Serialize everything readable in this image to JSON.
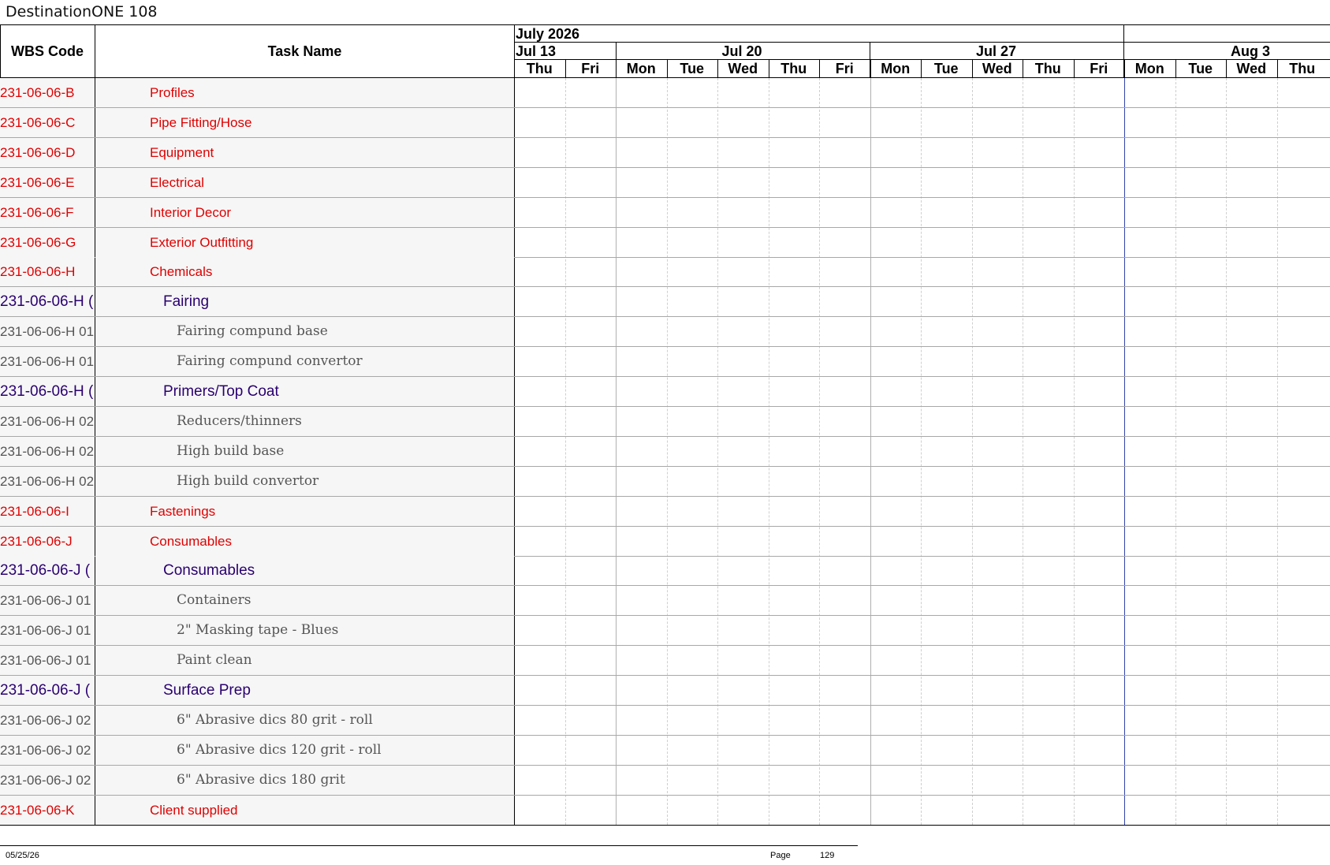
{
  "doc_title": "DestinationONE 108",
  "columns": {
    "wbs": "WBS Code",
    "task": "Task Name"
  },
  "timeline": {
    "month": "July 2026",
    "weeks": [
      "Jul 13",
      "Jul 20",
      "Jul 27",
      "Aug 3"
    ],
    "days": [
      "Thu",
      "Fri",
      "Mon",
      "Tue",
      "Wed",
      "Thu",
      "Fri",
      "Mon",
      "Tue",
      "Wed",
      "Thu",
      "Fri",
      "Mon",
      "Tue",
      "Wed",
      "Thu"
    ]
  },
  "rows": [
    {
      "wbs": "231-06-06-B",
      "task": "Profiles",
      "level": 1
    },
    {
      "wbs": "231-06-06-C",
      "task": "Pipe Fitting/Hose",
      "level": 1
    },
    {
      "wbs": "231-06-06-D",
      "task": "Equipment",
      "level": 1
    },
    {
      "wbs": "231-06-06-E",
      "task": "Electrical",
      "level": 1
    },
    {
      "wbs": "231-06-06-F",
      "task": "Interior Decor",
      "level": 1
    },
    {
      "wbs": "231-06-06-G",
      "task": "Exterior Outfitting",
      "level": 1
    },
    {
      "wbs": "231-06-06-H",
      "task": "Chemicals",
      "level": 1
    },
    {
      "wbs": "231-06-06-H (",
      "task": "Fairing",
      "level": 2
    },
    {
      "wbs": "231-06-06-H 01",
      "task": "Fairing compund base",
      "level": 3
    },
    {
      "wbs": "231-06-06-H 01",
      "task": "Fairing compund convertor",
      "level": 3
    },
    {
      "wbs": "231-06-06-H (",
      "task": "Primers/Top Coat",
      "level": 2
    },
    {
      "wbs": "231-06-06-H 02",
      "task": "Reducers/thinners",
      "level": 3
    },
    {
      "wbs": "231-06-06-H 02",
      "task": "High build base",
      "level": 3
    },
    {
      "wbs": "231-06-06-H 02",
      "task": "High build convertor",
      "level": 3
    },
    {
      "wbs": "231-06-06-I",
      "task": "Fastenings",
      "level": 1
    },
    {
      "wbs": "231-06-06-J",
      "task": "Consumables",
      "level": 1
    },
    {
      "wbs": "231-06-06-J (",
      "task": "Consumables",
      "level": 2
    },
    {
      "wbs": "231-06-06-J 01",
      "task": "Containers",
      "level": 3
    },
    {
      "wbs": "231-06-06-J 01",
      "task": "2\" Masking tape - Blues",
      "level": 3
    },
    {
      "wbs": "231-06-06-J 01",
      "task": "Paint clean",
      "level": 3
    },
    {
      "wbs": "231-06-06-J (",
      "task": "Surface Prep",
      "level": 2
    },
    {
      "wbs": "231-06-06-J 02",
      "task": "6\" Abrasive dics 80 grit - roll",
      "level": 3
    },
    {
      "wbs": "231-06-06-J 02",
      "task": "6\" Abrasive dics 120 grit - roll",
      "level": 3
    },
    {
      "wbs": "231-06-06-J 02",
      "task": "6\" Abrasive dics 180 grit",
      "level": 3
    },
    {
      "wbs": "231-06-06-K",
      "task": "Client supplied",
      "level": 1
    }
  ],
  "footer": {
    "date": "05/25/26",
    "page_label": "Page",
    "page_number": "129"
  },
  "colors": {
    "level1": "#e00000",
    "level2": "#2a0070",
    "level3": "#555555",
    "today_line": "#3344aa"
  }
}
